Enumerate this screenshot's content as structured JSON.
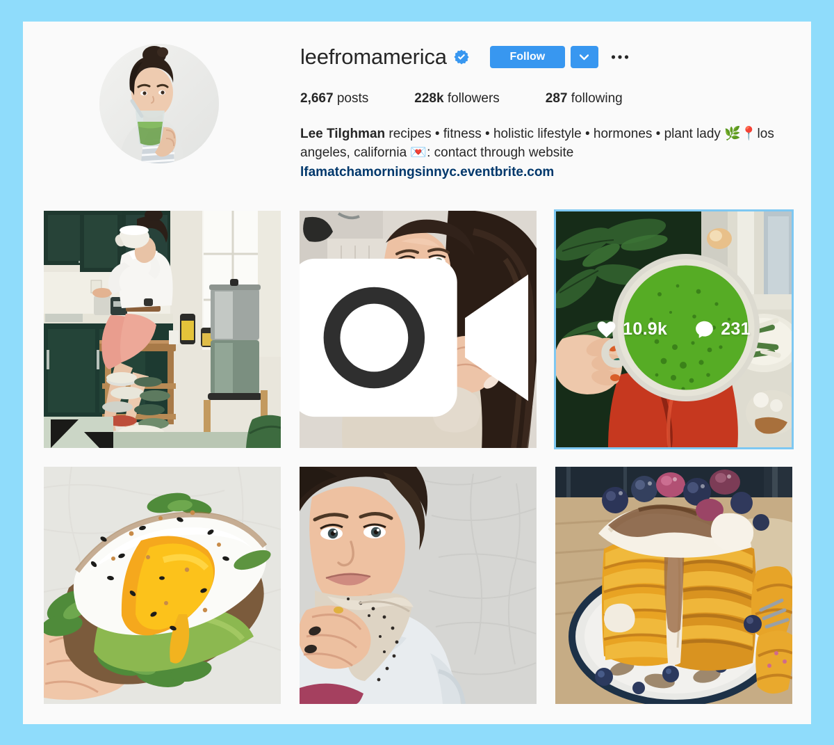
{
  "theme": {
    "page_background": "#8fdcfb",
    "card_background": "#fafafa",
    "accent_blue": "#3897f0",
    "link_blue": "#00376b",
    "selection_blue": "#7ec8f2",
    "text_primary": "#262626"
  },
  "profile": {
    "username": "leefromamerica",
    "verified_icon": "verified-badge-icon",
    "avatar_icon": "profile-avatar",
    "avatar_alt": "Woman with dark hair in a bun drinking a green smoothie",
    "follow_label": "Follow",
    "follow_dropdown_icon": "chevron-down-icon",
    "options_icon": "ellipsis-icon",
    "stats": [
      {
        "value": "2,667",
        "label": "posts",
        "name": "posts"
      },
      {
        "value": "228k",
        "label": "followers",
        "name": "followers"
      },
      {
        "value": "287",
        "label": "following",
        "name": "following"
      }
    ],
    "bio": {
      "full_name": "Lee Tilghman",
      "text": " recipes • fitness • holistic lifestyle • hormones • plant lady 🌿📍los angeles, california 💌: contact through website",
      "link": "lfamatchamorningsinnyc.eventbrite.com"
    }
  },
  "posts": [
    {
      "name": "post-kitchen-coffee",
      "alt": "Woman in white tee and pink pants sitting on a counter in a dark green kitchen drinking from a mug",
      "is_video": false,
      "selected": false,
      "likes": null,
      "comments": null
    },
    {
      "name": "post-hair-selfie-video",
      "alt": "Selfie of woman in cream hoodie touching her long brown hair",
      "is_video": true,
      "video_icon": "video-camera-icon",
      "selected": false,
      "likes": null,
      "comments": null
    },
    {
      "name": "post-matcha-latte",
      "alt": "Hand holding a bowl of bright green matcha latte over red pants with plants nearby",
      "is_video": false,
      "selected": true,
      "likes": "10.9k",
      "comments": "231",
      "like_icon": "heart-icon",
      "comment_icon": "comment-bubble-icon"
    },
    {
      "name": "post-avocado-egg-toast",
      "alt": "Hand holding avocado toast topped with a fried egg with runny yolk and greens",
      "is_video": false,
      "selected": false,
      "likes": null,
      "comments": null
    },
    {
      "name": "post-portrait-bandana",
      "alt": "Portrait of woman in white tee with bandana scarf against a textured gray wall",
      "is_video": false,
      "selected": false,
      "likes": null,
      "comments": null
    },
    {
      "name": "post-pancake-stack",
      "alt": "Tall stack of golden pancakes with cream, berries and sauce on a blue rimmed plate",
      "is_video": false,
      "selected": false,
      "likes": null,
      "comments": null
    }
  ]
}
